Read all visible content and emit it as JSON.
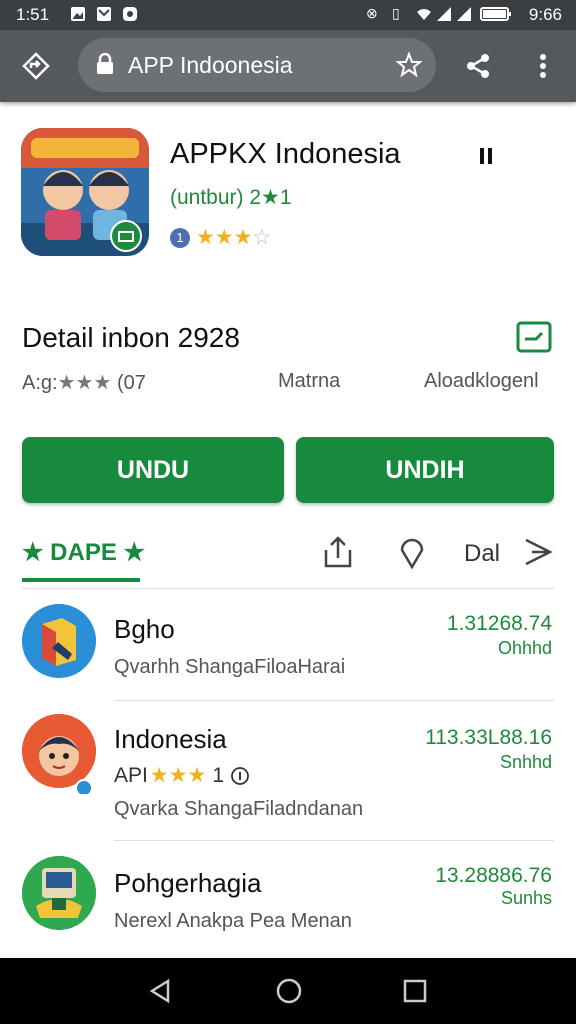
{
  "status_bar": {
    "time": "1:51",
    "clock_right": "9:66"
  },
  "browser": {
    "url": "APP Indoonesia"
  },
  "app": {
    "title": "APPKX Indonesia",
    "subtitle": "(untbur) 2★1",
    "info_badge": "1",
    "rating": 3,
    "rating_max": 4
  },
  "detail": {
    "title": "Detail inbon 2928",
    "meta_left_prefix": "A:g:",
    "meta_left_stars": "★★★",
    "meta_left_suffix": "(07",
    "meta_middle": "Matrna",
    "meta_right": "Aloadklogenl"
  },
  "buttons": {
    "primary_label": "UNDU",
    "secondary_label": "UNDIH"
  },
  "tabs": {
    "active_label": "★ DAPE ★",
    "text_tab": "Dal"
  },
  "list": [
    {
      "name": "Bgho",
      "desc": "Qvarhh ShangaFiloaHarai",
      "num": "1.31268.74",
      "sub": "Ohhhd"
    },
    {
      "name": "Indonesia",
      "rating_prefix": "API",
      "rating_stars": 3,
      "rating_suffix": "1",
      "desc": "Qvarka ShangaFiladndanan",
      "num": "113.33L88.16",
      "sub": "Snhhd"
    },
    {
      "name": "Pohgerhagia",
      "desc": "Nerexl Anakpa Pea Menan",
      "num": "13.28886.76",
      "sub": "Sunhs"
    }
  ],
  "colors": {
    "accent": "#178a3e",
    "toolbar": "#55585c",
    "status_bar": "#3b3f44",
    "star": "#f2b01e"
  }
}
